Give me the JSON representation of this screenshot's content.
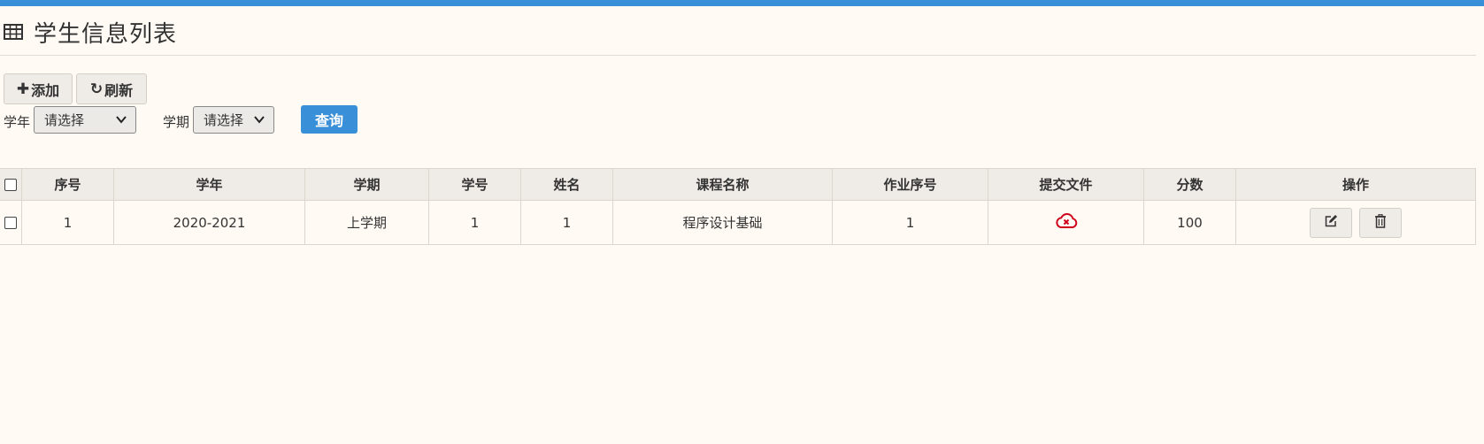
{
  "header": {
    "title": "学生信息列表",
    "icon": "table-icon"
  },
  "toolbar": {
    "add_label": "添加",
    "refresh_label": "刷新",
    "add_icon": "plus-icon",
    "refresh_icon": "refresh-icon"
  },
  "filters": {
    "year_label": "学年",
    "year_value": "请选择",
    "term_label": "学期",
    "term_value": "请选择",
    "query_label": "查询"
  },
  "table": {
    "columns": [
      "序号",
      "学年",
      "学期",
      "学号",
      "姓名",
      "课程名称",
      "作业序号",
      "提交文件",
      "分数",
      "操作"
    ],
    "rows": [
      {
        "index": "1",
        "year": "2020-2021",
        "term": "上学期",
        "student_id": "1",
        "name": "1",
        "course": "程序设计基础",
        "homework_no": "1",
        "file_icon": "cloud-error-icon",
        "score": "100"
      }
    ]
  },
  "colors": {
    "accent": "#3a8fd9",
    "background": "#fffaf4",
    "error": "#d0021b"
  }
}
